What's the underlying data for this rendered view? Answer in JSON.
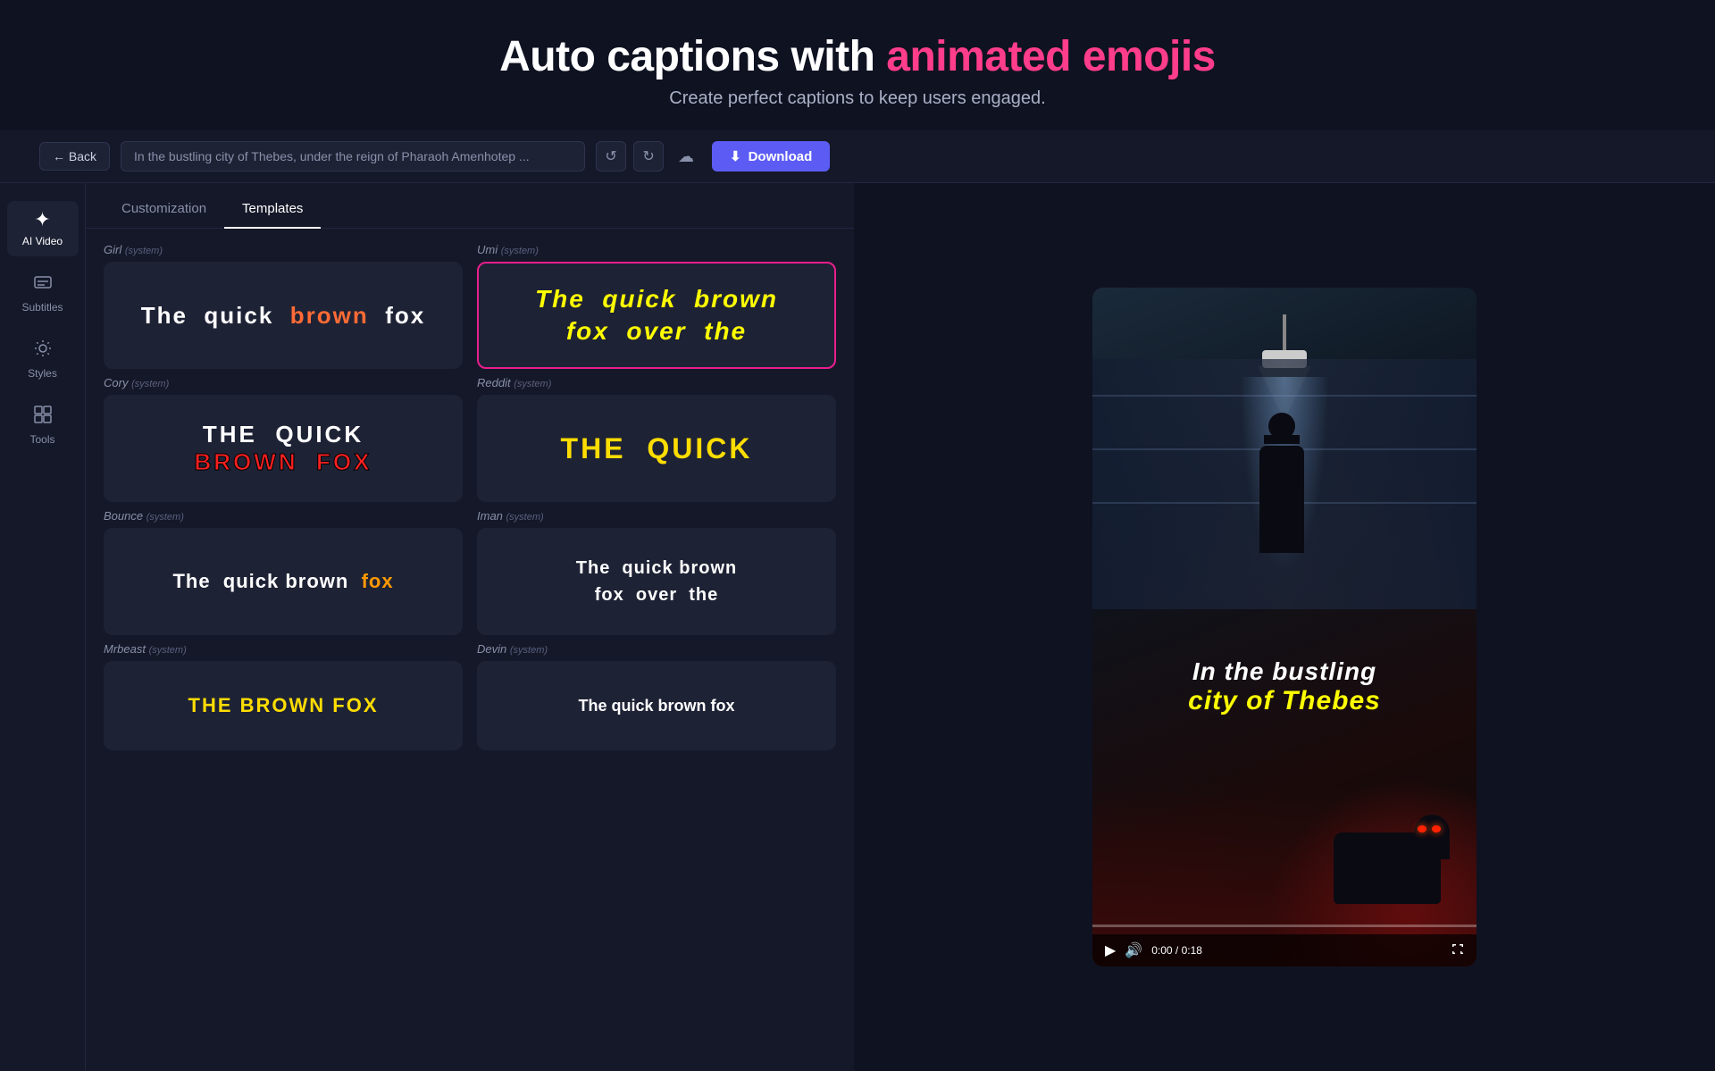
{
  "header": {
    "title_plain": "Auto captions with ",
    "title_highlight": "animated emojis",
    "subtitle": "Create perfect captions to keep users engaged."
  },
  "toolbar": {
    "back_label": "← Back",
    "text_content": "In the bustling city of Thebes, under the reign of Pharaoh Amenhotep ...",
    "download_label": "Download",
    "download_icon": "⬇"
  },
  "sidebar": {
    "items": [
      {
        "id": "ai-video",
        "icon": "✦",
        "label": "AI Video"
      },
      {
        "id": "subtitles",
        "icon": "⊟",
        "label": "Subtitles"
      },
      {
        "id": "styles",
        "icon": "✿",
        "label": "Styles"
      },
      {
        "id": "tools",
        "icon": "⊞",
        "label": "Tools"
      }
    ]
  },
  "tabs": {
    "items": [
      {
        "id": "customization",
        "label": "Customization"
      },
      {
        "id": "templates",
        "label": "Templates",
        "active": true
      }
    ]
  },
  "templates": {
    "columns": [
      [
        {
          "id": "girl",
          "name": "Girl",
          "tag": "(system)",
          "preview_text": "The  quick  brown  fox",
          "selected": false
        },
        {
          "id": "cory",
          "name": "Cory",
          "tag": "(system)",
          "preview_line1": "THE  QUICK",
          "preview_line2": "BROWN  FOX",
          "selected": false
        },
        {
          "id": "bounce",
          "name": "Bounce",
          "tag": "(system)",
          "preview_text": "The  quick brown  fox",
          "selected": false
        },
        {
          "id": "mrbeast",
          "name": "Mrbeast",
          "tag": "(system)",
          "selected": false
        }
      ],
      [
        {
          "id": "umi",
          "name": "Umi",
          "tag": "(system)",
          "preview_line1": "The  quick  brown",
          "preview_line2": "fox  over  the",
          "selected": true
        },
        {
          "id": "reddit",
          "name": "Reddit",
          "tag": "(system)",
          "preview_text": "THE  QUICK",
          "selected": false
        },
        {
          "id": "iman",
          "name": "Iman",
          "tag": "(system)",
          "preview_line1": "The  quick brown",
          "preview_line2": "fox  over  the",
          "selected": false
        },
        {
          "id": "devin",
          "name": "Devin",
          "tag": "(system)",
          "selected": false
        }
      ]
    ]
  },
  "video": {
    "caption_line1": "In the bustling",
    "caption_line2": "city of Thebes",
    "time_current": "0:00",
    "time_total": "0:18",
    "time_display": "0:00 / 0:18",
    "progress_percent": 0
  },
  "colors": {
    "accent_pink": "#e91e8c",
    "accent_yellow": "#ffff00",
    "accent_red": "#ff2020",
    "accent_orange": "#ff9900",
    "bg_dark": "#0f1221",
    "bg_panel": "#151828",
    "bg_card": "#1e2235"
  }
}
